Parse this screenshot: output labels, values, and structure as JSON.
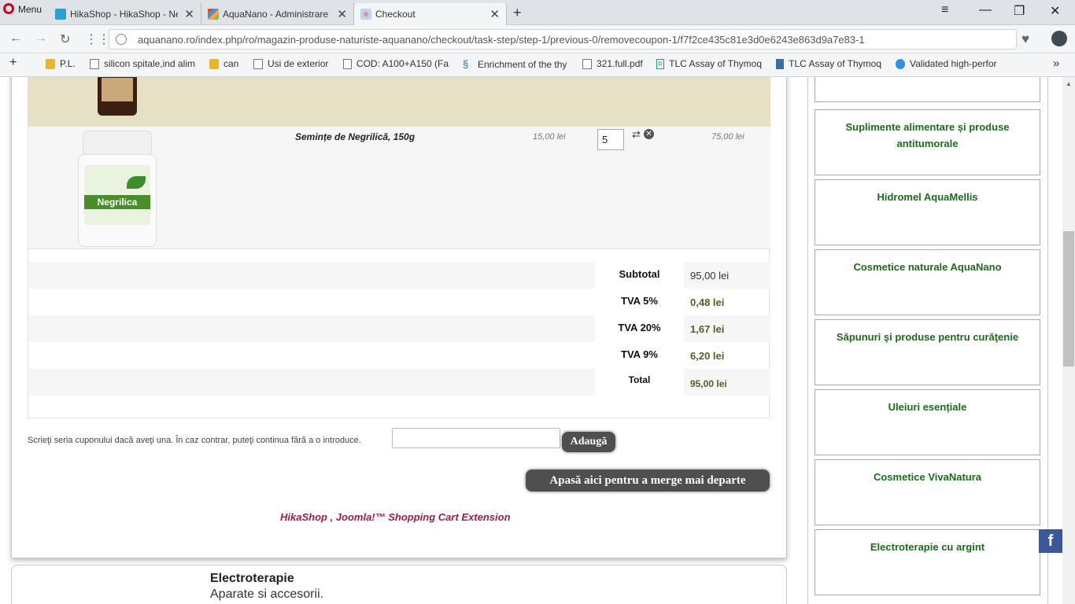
{
  "browser": {
    "menu_label": "Menu",
    "tabs": [
      {
        "title": "HikaShop - HikaShop - Ne",
        "active": false
      },
      {
        "title": "AquaNano - Administrare",
        "active": false
      },
      {
        "title": "Checkout",
        "active": true
      }
    ],
    "new_tab": "+",
    "url": "aquanano.ro/index.php/ro/magazin-produse-naturiste-aquanano/checkout/task-step/step-1/previous-0/removecoupon-1/f7f2ce435c81e3d0e6243e863d9a7e83-1",
    "bookmarks": [
      {
        "label": "P.L.",
        "icon": "folder-icon"
      },
      {
        "label": "silicon spitale,ind alim",
        "icon": "page-icon"
      },
      {
        "label": "can",
        "icon": "folder-icon"
      },
      {
        "label": "Usi de exterior",
        "icon": "page-icon"
      },
      {
        "label": "COD: A100+A150 (Fa",
        "icon": "page-icon"
      },
      {
        "label": "Enrichment of the thy",
        "icon": "dna-icon"
      },
      {
        "label": "321.full.pdf",
        "icon": "page-icon"
      },
      {
        "label": "TLC Assay of Thymoq",
        "icon": "rg-icon"
      },
      {
        "label": "TLC Assay of Thymoq",
        "icon": "doc-blue-icon"
      },
      {
        "label": "Validated high-perfor",
        "icon": "globe-blue-icon"
      }
    ],
    "bookmarks_more": "»"
  },
  "cart": {
    "product": {
      "name": "Semințe de Negrilică, 150g",
      "unit_price": "15,00 lei",
      "quantity": "5",
      "total": "75,00 lei",
      "jar_label": "Negrilica"
    },
    "totals": [
      {
        "label": "Subtotal",
        "value": "95,00 lei"
      },
      {
        "label": "TVA 5%",
        "value": "0,48 lei"
      },
      {
        "label": "TVA 20%",
        "value": "1,67 lei"
      },
      {
        "label": "TVA 9%",
        "value": "6,20 lei"
      },
      {
        "label": "Total",
        "value": "95,00 lei"
      }
    ],
    "coupon_text": "Scrieţi seria cuponului dacă aveţi una. În caz contrar, puteţi continua fără a o introduce.",
    "coupon_button": "Adaugă",
    "next_button": "Apasă aici pentru a merge mai departe",
    "footer_link": "HikaShop , Joomla!™ Shopping Cart Extension"
  },
  "electro": {
    "title": "Electroterapie",
    "subtitle": "Aparate si accesorii."
  },
  "sidebar": {
    "categories": [
      "Suplimente alimentare și produse antitumorale",
      "Hidromel AquaMellis",
      "Cosmetice naturale AquaNano",
      "Săpunuri şi produse pentru curăţenie",
      "Uleiuri esențiale",
      "Cosmetice VivaNatura",
      "Electroterapie cu argint"
    ],
    "facebook": "f"
  }
}
